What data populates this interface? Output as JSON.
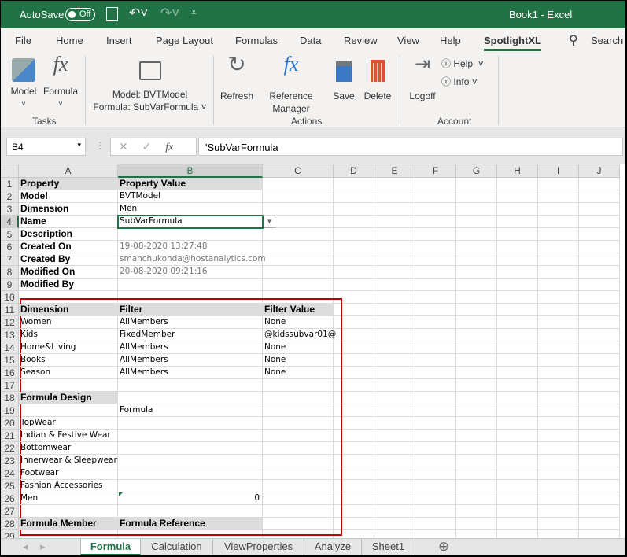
{
  "title": {
    "autosave": "AutoSave",
    "toggle": "Off",
    "doc": "Book1  -  Excel"
  },
  "menu": [
    "File",
    "Home",
    "Insert",
    "Page Layout",
    "Formulas",
    "Data",
    "Review",
    "View",
    "Help",
    "SpotlightXL"
  ],
  "search": "Search",
  "ribbon": {
    "model": "Model",
    "formula": "Formula",
    "tasks": "Tasks",
    "model_info": "Model: BVTModel",
    "formula_info": "Formula: SubVarFormula",
    "refresh": "Refresh",
    "ref1": "Reference",
    "ref2": "Manager",
    "save": "Save",
    "delete": "Delete",
    "actions": "Actions",
    "logoff": "Logoff",
    "help": "Help",
    "info": "Info",
    "account": "Account"
  },
  "formula_bar": {
    "namebox": "B4",
    "value": "'SubVarFormula"
  },
  "columns": [
    "A",
    "B",
    "C",
    "D",
    "E",
    "F",
    "G",
    "H",
    "I",
    "J"
  ],
  "rows": [
    [
      {
        "t": "Property",
        "s": "h"
      },
      {
        "t": "Property Value",
        "s": "h"
      },
      {
        "t": ""
      }
    ],
    [
      {
        "t": "Model",
        "s": "b"
      },
      {
        "t": "BVTModel"
      },
      {
        "t": ""
      }
    ],
    [
      {
        "t": "Dimension",
        "s": "b"
      },
      {
        "t": "Men"
      },
      {
        "t": ""
      }
    ],
    [
      {
        "t": "Name",
        "s": "b"
      },
      {
        "t": "SubVarFormula"
      },
      {
        "t": ""
      }
    ],
    [
      {
        "t": "Description",
        "s": "b"
      },
      {
        "t": ""
      },
      {
        "t": ""
      }
    ],
    [
      {
        "t": "Created On",
        "s": "b"
      },
      {
        "t": "19-08-2020 13:27:48",
        "s": "g"
      },
      {
        "t": ""
      }
    ],
    [
      {
        "t": "Created By",
        "s": "b"
      },
      {
        "t": "smanchukonda@hostanalytics.com",
        "s": "g"
      },
      {
        "t": ""
      }
    ],
    [
      {
        "t": "Modified On",
        "s": "b"
      },
      {
        "t": "20-08-2020 09:21:16",
        "s": "g"
      },
      {
        "t": ""
      }
    ],
    [
      {
        "t": "Modified By",
        "s": "b"
      },
      {
        "t": ""
      },
      {
        "t": ""
      }
    ],
    [
      {
        "t": ""
      },
      {
        "t": ""
      },
      {
        "t": ""
      }
    ],
    [
      {
        "t": "Dimension",
        "s": "h"
      },
      {
        "t": "Filter",
        "s": "h"
      },
      {
        "t": "Filter Value",
        "s": "h"
      }
    ],
    [
      {
        "t": "Women"
      },
      {
        "t": "AllMembers"
      },
      {
        "t": "None"
      }
    ],
    [
      {
        "t": "Kids"
      },
      {
        "t": "FixedMember"
      },
      {
        "t": "@kidssubvar01@"
      }
    ],
    [
      {
        "t": "Home&Living"
      },
      {
        "t": "AllMembers"
      },
      {
        "t": "None"
      }
    ],
    [
      {
        "t": "Books"
      },
      {
        "t": "AllMembers"
      },
      {
        "t": "None"
      }
    ],
    [
      {
        "t": "Season"
      },
      {
        "t": "AllMembers"
      },
      {
        "t": "None"
      }
    ],
    [
      {
        "t": ""
      },
      {
        "t": ""
      },
      {
        "t": ""
      }
    ],
    [
      {
        "t": "Formula Design",
        "s": "h"
      },
      {
        "t": ""
      },
      {
        "t": ""
      }
    ],
    [
      {
        "t": ""
      },
      {
        "t": "Formula"
      },
      {
        "t": ""
      }
    ],
    [
      {
        "t": "TopWear"
      },
      {
        "t": ""
      },
      {
        "t": ""
      }
    ],
    [
      {
        "t": "Indian & Festive Wear"
      },
      {
        "t": ""
      },
      {
        "t": ""
      }
    ],
    [
      {
        "t": "Bottomwear"
      },
      {
        "t": ""
      },
      {
        "t": ""
      }
    ],
    [
      {
        "t": "Innerwear & Sleepwear"
      },
      {
        "t": ""
      },
      {
        "t": ""
      }
    ],
    [
      {
        "t": "Footwear"
      },
      {
        "t": ""
      },
      {
        "t": ""
      }
    ],
    [
      {
        "t": "Fashion Accessories"
      },
      {
        "t": ""
      },
      {
        "t": ""
      }
    ],
    [
      {
        "t": "Men"
      },
      {
        "t": "0",
        "s": "r"
      },
      {
        "t": ""
      }
    ],
    [
      {
        "t": ""
      },
      {
        "t": ""
      },
      {
        "t": ""
      }
    ],
    [
      {
        "t": "Formula Member",
        "s": "h"
      },
      {
        "t": "Formula Reference",
        "s": "h"
      },
      {
        "t": ""
      }
    ],
    [
      {
        "t": ""
      },
      {
        "t": ""
      },
      {
        "t": ""
      }
    ]
  ],
  "sheets": [
    "Formula",
    "Calculation",
    "ViewProperties",
    "Analyze",
    "Sheet1"
  ],
  "active_sheet": "Formula",
  "colors": {
    "excel_green": "#217346",
    "highlight_box": "#c00000"
  }
}
